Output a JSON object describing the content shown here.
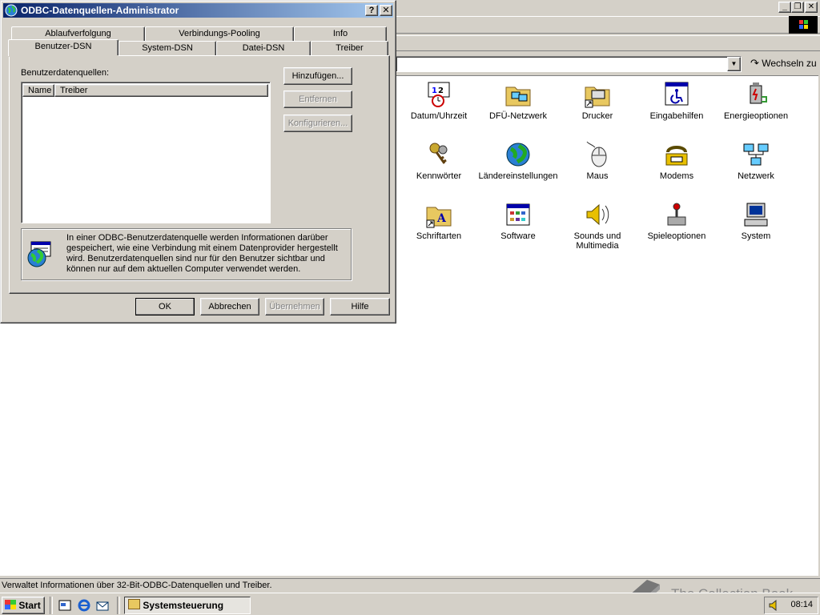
{
  "explorer": {
    "address_value": "",
    "go_label": "Wechseln zu",
    "status_text": "Verwaltet Informationen über 32-Bit-ODBC-Datenquellen und Treiber.",
    "items": [
      {
        "label": "Datum/Uhrzeit",
        "icon": "clock-calendar-icon"
      },
      {
        "label": "DFÜ-Netzwerk",
        "icon": "dialup-network-folder-icon"
      },
      {
        "label": "Drucker",
        "icon": "printer-folder-icon"
      },
      {
        "label": "Eingabehilfen",
        "icon": "accessibility-icon"
      },
      {
        "label": "Energieoptionen",
        "icon": "power-options-icon"
      },
      {
        "label": "Kennwörter",
        "icon": "keys-icon"
      },
      {
        "label": "Ländereinstellungen",
        "icon": "globe-icon"
      },
      {
        "label": "Maus",
        "icon": "mouse-icon"
      },
      {
        "label": "Modems",
        "icon": "modem-phone-icon"
      },
      {
        "label": "Netzwerk",
        "icon": "network-icon"
      },
      {
        "label": "Schriftarten",
        "icon": "fonts-folder-icon"
      },
      {
        "label": "Software",
        "icon": "software-icon"
      },
      {
        "label": "Sounds und Multimedia",
        "icon": "speaker-icon"
      },
      {
        "label": "Spieleoptionen",
        "icon": "joystick-icon"
      },
      {
        "label": "System",
        "icon": "computer-icon"
      }
    ]
  },
  "dialog": {
    "title": "ODBC-Datenquellen-Administrator",
    "help_btn": "?",
    "close_btn": "✕",
    "tabs_back": [
      "Ablaufverfolgung",
      "Verbindungs-Pooling",
      "Info"
    ],
    "tabs_front": [
      "Benutzer-DSN",
      "System-DSN",
      "Datei-DSN",
      "Treiber"
    ],
    "list_label": "Benutzerdatenquellen:",
    "columns": [
      "Name",
      "Treiber"
    ],
    "buttons": {
      "add": "Hinzufügen...",
      "remove": "Entfernen",
      "configure": "Konfigurieren..."
    },
    "info_text": "In einer ODBC-Benutzerdatenquelle werden Informationen darüber gespeichert, wie eine Verbindung mit einem Datenprovider hergestellt wird. Benutzerdatenquellen sind nur für den Benutzer sichtbar und können nur auf dem aktuellen Computer verwendet werden.",
    "footer": {
      "ok": "OK",
      "cancel": "Abbrechen",
      "apply": "Übernehmen",
      "help": "Hilfe"
    }
  },
  "taskbar": {
    "start": "Start",
    "task": "Systemsteuerung",
    "clock": "08:14"
  },
  "watermark": "The Collection Book",
  "colors": {
    "title_active": "#0a246a",
    "title_gradient_end": "#a6caf0",
    "face": "#d4d0c8"
  }
}
